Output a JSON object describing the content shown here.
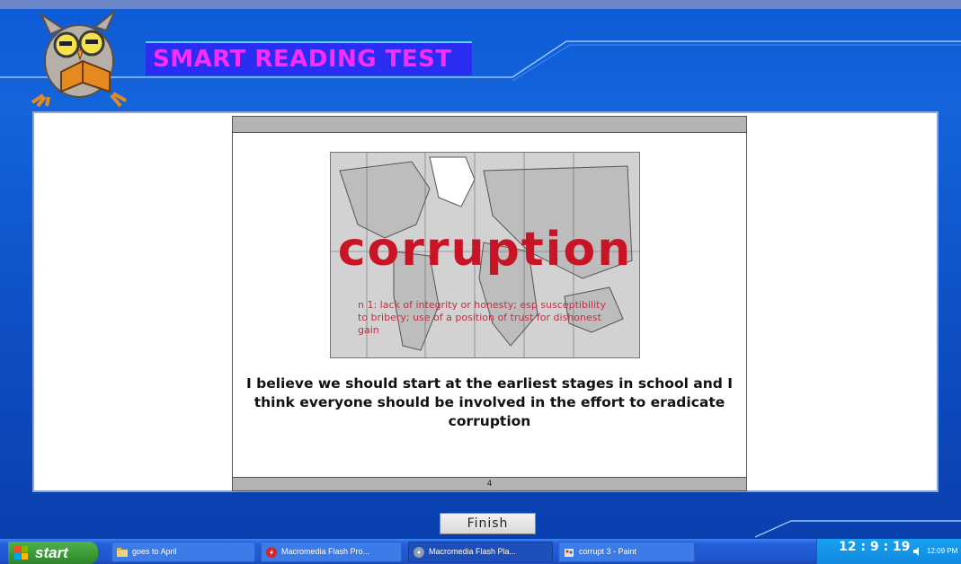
{
  "app": {
    "title": "SMART READING TEST"
  },
  "slide": {
    "image_word": "corruption",
    "image_definition": "n 1: lack of integrity or honesty; esp susceptibility to bribery; use of a position of trust for dishonest gain",
    "caption": "I believe we should start at the earliest stages in school and I think everyone should be involved in the effort to eradicate corruption",
    "page_number": "4"
  },
  "finish_button": {
    "label": "Finish"
  },
  "taskbar": {
    "start_label": "start",
    "items": [
      {
        "label": "goes to April",
        "icon": "folder-icon"
      },
      {
        "label": "Macromedia Flash Pro...",
        "icon": "flash-icon"
      },
      {
        "label": "Macromedia Flash Pla...",
        "icon": "flash-player-icon"
      },
      {
        "label": "corrupt 3 - Paint",
        "icon": "paint-icon"
      }
    ],
    "app_clock": "12 : 9 : 19",
    "system_time": "12:09 PM"
  },
  "colors": {
    "title_text": "#ff2cff",
    "title_bg": "#2a2ef0",
    "background": "#1464dc",
    "corruption_word": "#c91426"
  }
}
